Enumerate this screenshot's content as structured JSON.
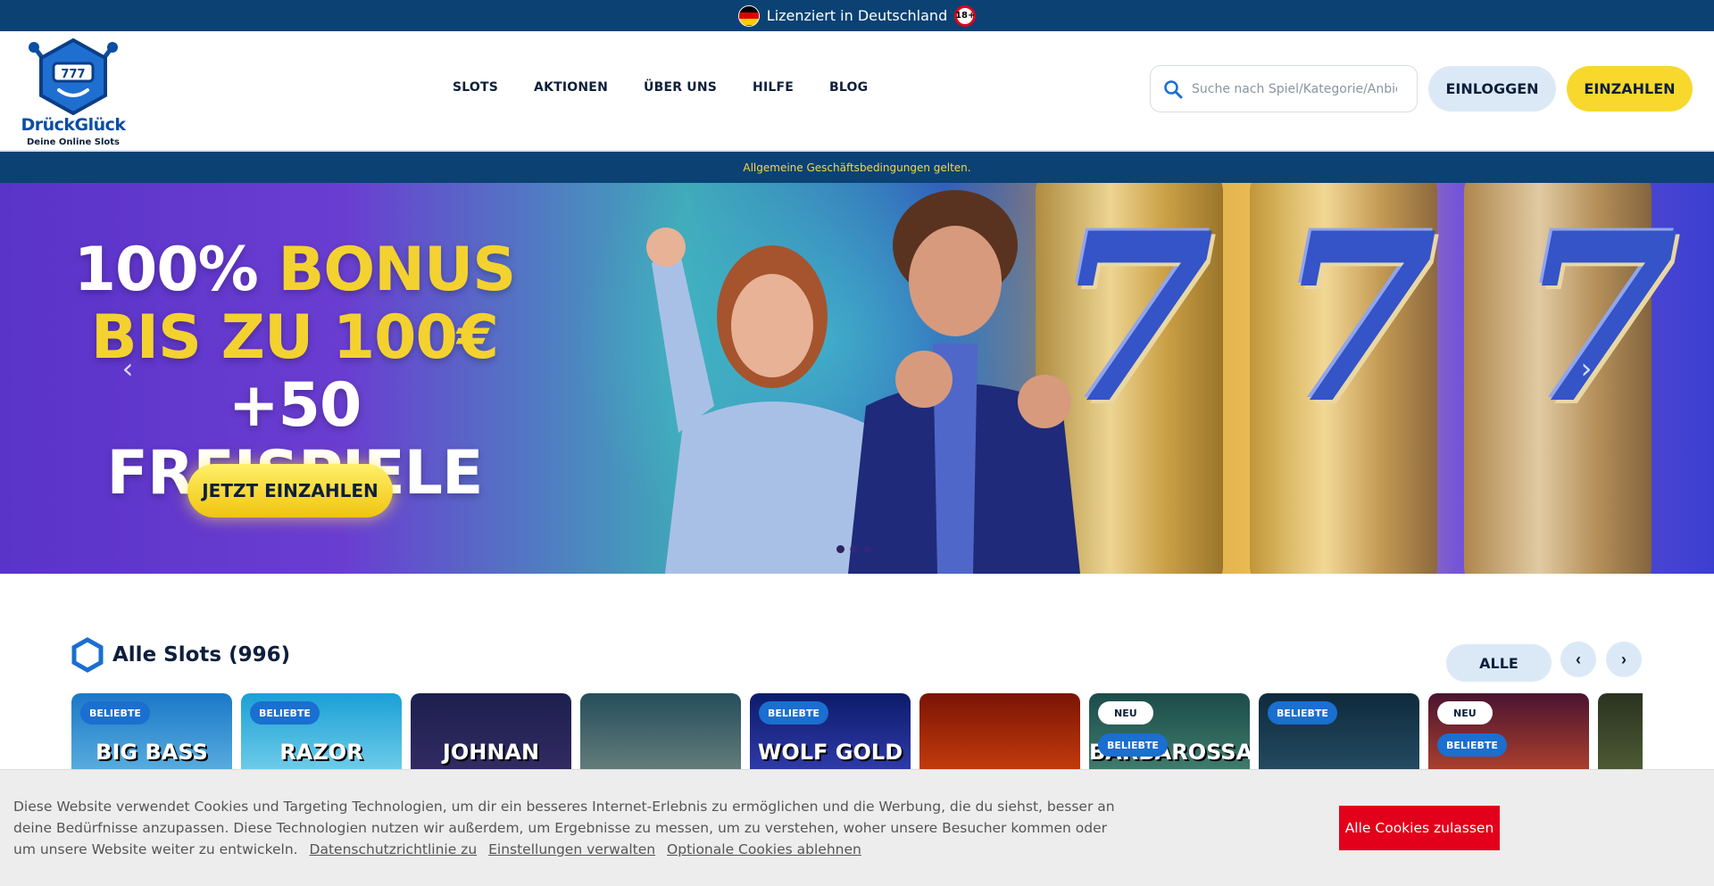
{
  "topbar": {
    "license_text": "Lizenziert in Deutschland",
    "age_badge": "18+"
  },
  "header": {
    "logo_name": "DrückGlück",
    "logo_tagline": "Deine Online Slots",
    "nav": [
      "SLOTS",
      "AKTIONEN",
      "ÜBER UNS",
      "HILFE",
      "BLOG"
    ],
    "search_placeholder": "Suche nach Spiel/Kategorie/Anbieter",
    "login_label": "EINLOGGEN",
    "deposit_label": "EINZAHLEN"
  },
  "terms_notice": "Allgemeine Geschäftsbedingungen gelten.",
  "hero": {
    "line1_white": "100%",
    "line1_yellow": "BONUS",
    "line2": "BIS ZU 100€",
    "line3": "+50 FREISPIELE",
    "cta_label": "JETZT EINZAHLEN",
    "slide_count": 3,
    "active_slide": 1
  },
  "slots": {
    "title": "Alle Slots (996)",
    "filter_label": "ALLE",
    "tiles": [
      {
        "name": "BIG BASS",
        "badges": [
          "BELIEBTE"
        ],
        "colors": [
          "#1b78c7",
          "#6fc0e6"
        ]
      },
      {
        "name": "RAZOR",
        "badges": [
          "BELIEBTE"
        ],
        "colors": [
          "#1aa0d6",
          "#8fdcf0"
        ]
      },
      {
        "name": "JOHNAN",
        "badges": [],
        "colors": [
          "#1c1f4d",
          "#3a2f6b"
        ]
      },
      {
        "name": "",
        "badges": [],
        "colors": [
          "#254e5c",
          "#7c8f86"
        ]
      },
      {
        "name": "WOLF GOLD",
        "badges": [
          "BELIEBTE"
        ],
        "colors": [
          "#0d1b6b",
          "#3b47c0"
        ]
      },
      {
        "name": "",
        "badges": [],
        "colors": [
          "#7a1405",
          "#e04a0f"
        ]
      },
      {
        "name": "BARBAROSSA",
        "badges": [
          "NEU",
          "BELIEBTE"
        ],
        "colors": [
          "#1b4c4a",
          "#4e8f7a"
        ]
      },
      {
        "name": "",
        "badges": [
          "BELIEBTE"
        ],
        "colors": [
          "#0f2a3c",
          "#2b5870"
        ]
      },
      {
        "name": "",
        "badges": [
          "NEU",
          "BELIEBTE"
        ],
        "colors": [
          "#4a1430",
          "#d1502c"
        ]
      },
      {
        "name": "",
        "badges": [],
        "colors": [
          "#2a3320",
          "#5a6a3c"
        ]
      }
    ]
  },
  "cookie": {
    "text": "Diese Website verwendet Cookies und Targeting Technologien, um dir ein besseres Internet-Erlebnis zu ermöglichen und die Werbung, die du siehst, besser an deine Bedürfnisse anzupassen. Diese Technologien nutzen wir außerdem, um Ergebnisse zu messen, um zu verstehen, woher unsere Besucher kommen oder um unsere Website weiter zu entwickeln.",
    "link_privacy": "Datenschutzrichtlinie zu",
    "link_settings": "Einstellungen verwalten",
    "link_decline": "Optionale Cookies ablehnen",
    "accept_label": "Alle Cookies zulassen"
  },
  "colors": {
    "navy": "#0b4273",
    "yellow": "#f8d82c",
    "light_blue": "#dbe9f7",
    "cookie_red": "#e2001a"
  }
}
